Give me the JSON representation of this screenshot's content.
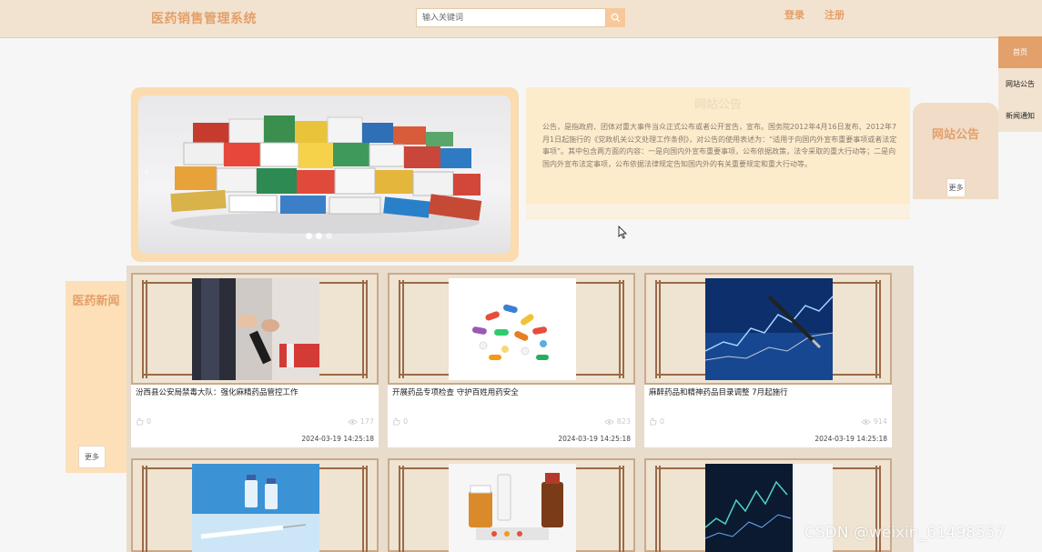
{
  "header": {
    "logo": "医药销售管理系统",
    "search_placeholder": "输入关键词",
    "login": "登录",
    "register": "注册"
  },
  "side_nav": [
    {
      "label": "首页",
      "active": true
    },
    {
      "label": "网站公告",
      "active": false
    },
    {
      "label": "新闻通知",
      "active": false
    }
  ],
  "notice": {
    "title": "网站公告",
    "text": "公告，是指政府、团体对重大事件当众正式公布或者公开宣告，宣布。国务院2012年4月16日发布、2012年7月1日起施行的《党政机关公文处理工作条例》，对公告的使用表述为：“适用于向国内外宣布重要事项或者法定事项”。其中包含两方面的内容：一是向国内外宣布重要事项，公布依据政策，法令采取的重大行动等；二是向国内外宣布法定事项，公布依据法律规定告知国内外的有关重要规定和重大行动等。",
    "side_title": "网站公告",
    "more": "更多"
  },
  "news": {
    "side_title": "医药新闻",
    "more": "更多",
    "cards": [
      {
        "title": "汾西县公安局禁毒大队：强化麻精药品管控工作",
        "likes": "0",
        "views": "177",
        "date": "2024-03-19 14:25:18"
      },
      {
        "title": "开展药品专项检查 守护百姓用药安全",
        "likes": "0",
        "views": "823",
        "date": "2024-03-19 14:25:18"
      },
      {
        "title": "麻醉药品和精神药品目录调整 7月起施行",
        "likes": "0",
        "views": "914",
        "date": "2024-03-19 14:25:18"
      }
    ]
  },
  "watermark": "CSDN @weixin_61498557",
  "colors": {
    "accent": "#e3a06a",
    "header_bg": "#f2e3d0",
    "notice_bg": "#fdeccc"
  }
}
